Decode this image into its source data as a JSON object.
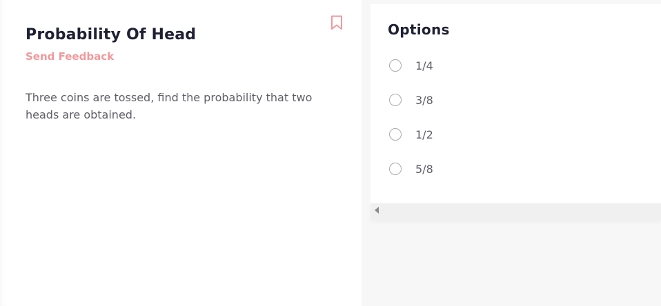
{
  "question": {
    "title": "Probability Of Head",
    "feedback_label": "Send Feedback",
    "text": "Three coins are tossed, find the probability that two heads are obtained.",
    "bookmarked": false
  },
  "options": {
    "title": "Options",
    "items": [
      {
        "label": "1/4",
        "selected": false
      },
      {
        "label": "3/8",
        "selected": false
      },
      {
        "label": "1/2",
        "selected": false
      },
      {
        "label": "5/8",
        "selected": false
      }
    ]
  },
  "colors": {
    "accent": "#f0999c",
    "title": "#1e2134",
    "body_text": "#5e5e66",
    "radio_border": "#a9a9ad"
  },
  "icons": {
    "bookmark": "bookmark-icon",
    "scroll_left": "scroll-left-arrow-icon"
  }
}
